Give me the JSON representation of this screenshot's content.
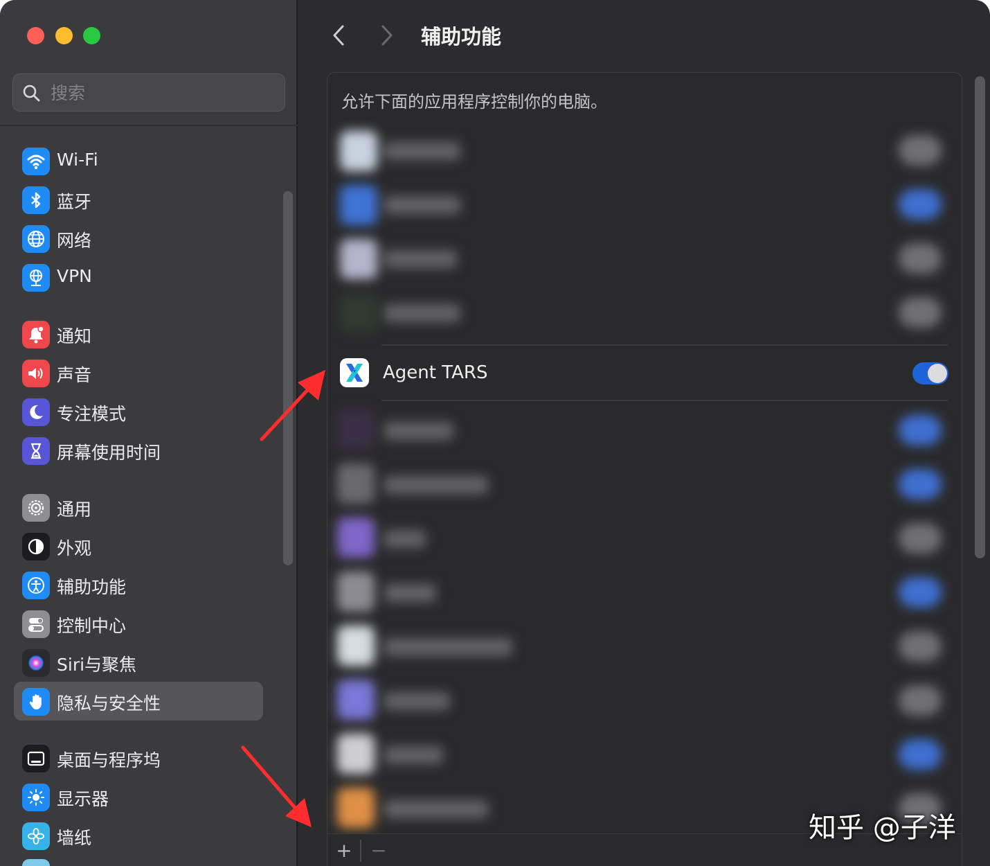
{
  "search": {
    "placeholder": "搜索"
  },
  "sidebar": {
    "items": [
      {
        "label": "Wi-Fi",
        "icon": "wifi-icon",
        "color": "#1f8cf6"
      },
      {
        "label": "蓝牙",
        "icon": "bluetooth-icon",
        "color": "#1f8cf6"
      },
      {
        "label": "网络",
        "icon": "globe-icon",
        "color": "#1f8cf6"
      },
      {
        "label": "VPN",
        "icon": "vpn-globe-icon",
        "color": "#1f8cf6"
      },
      {
        "label": "通知",
        "icon": "bell-icon",
        "color": "#f0474d"
      },
      {
        "label": "声音",
        "icon": "speaker-icon",
        "color": "#f0474d"
      },
      {
        "label": "专注模式",
        "icon": "moon-icon",
        "color": "#5856d6"
      },
      {
        "label": "屏幕使用时间",
        "icon": "hourglass-icon",
        "color": "#5856d6"
      },
      {
        "label": "通用",
        "icon": "gear-icon",
        "color": "#8e8e93"
      },
      {
        "label": "外观",
        "icon": "appearance-icon",
        "color": "#1c1c1e"
      },
      {
        "label": "辅助功能",
        "icon": "accessibility-icon",
        "color": "#1f8cf6"
      },
      {
        "label": "控制中心",
        "icon": "toggles-icon",
        "color": "#8e8e93"
      },
      {
        "label": "Siri与聚焦",
        "icon": "siri-icon",
        "color": "#2b2b2e"
      },
      {
        "label": "隐私与安全性",
        "icon": "hand-icon",
        "color": "#1f8cf6",
        "selected": true
      },
      {
        "label": "桌面与程序坞",
        "icon": "dock-icon",
        "color": "#1c1c1e"
      },
      {
        "label": "显示器",
        "icon": "sun-icon",
        "color": "#1f8cf6"
      },
      {
        "label": "墙纸",
        "icon": "flower-icon",
        "color": "#35b3e8"
      }
    ]
  },
  "main": {
    "title": "辅助功能",
    "description": "允许下面的应用程序控制你的电脑。",
    "highlighted_app": {
      "name": "Agent TARS",
      "enabled": true,
      "icon": "agent-tars-icon"
    },
    "footer": {
      "add_label": "+",
      "remove_label": "−"
    }
  },
  "accent_color": "#1f63d8",
  "watermark": "知乎 @子洋"
}
